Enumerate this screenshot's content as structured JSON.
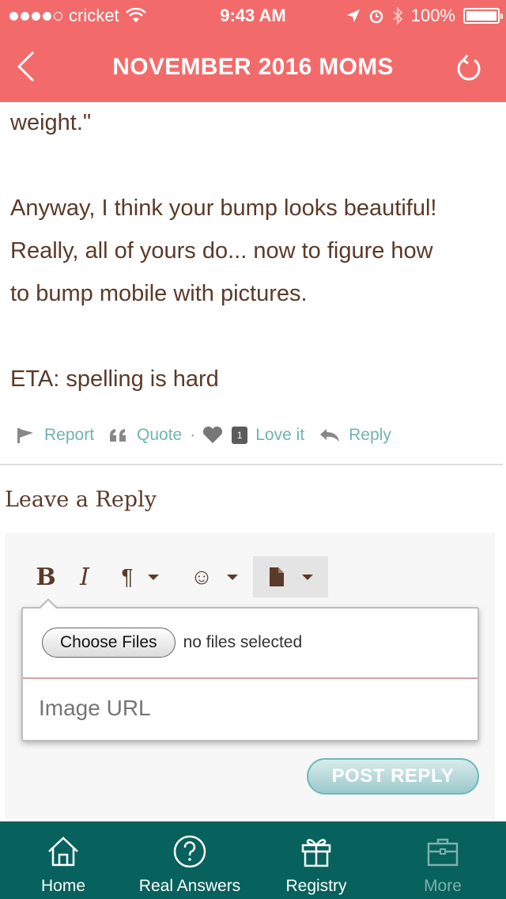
{
  "status_bar": {
    "carrier": "cricket",
    "time": "9:43 AM",
    "battery": "100%",
    "battery_fill": 1.0
  },
  "nav": {
    "title": "NOVEMBER 2016 MOMS"
  },
  "post": {
    "lines": [
      "weight.\"",
      "",
      "Anyway, I think your bump looks beautiful!",
      "Really, all of yours do... now to figure how",
      "to bump mobile with pictures.",
      "",
      "ETA: spelling is hard"
    ]
  },
  "actions": {
    "report": "Report",
    "quote": "Quote",
    "separator": "·",
    "love_count": "1",
    "love": "Love it",
    "reply": "Reply"
  },
  "reply_form": {
    "title": "Leave a Reply",
    "toolbar": {
      "bold": "B",
      "italic": "I",
      "paragraph": "¶",
      "emoji": "☺"
    },
    "file": {
      "choose_label": "Choose Files",
      "status": "no files selected"
    },
    "image_url": {
      "placeholder": "Image URL"
    },
    "submit_label": "POST REPLY"
  },
  "tabs": [
    {
      "label": "Home",
      "icon": "home-icon"
    },
    {
      "label": "Real Answers",
      "icon": "question-icon"
    },
    {
      "label": "Registry",
      "icon": "gift-icon"
    },
    {
      "label": "More",
      "icon": "briefcase-icon"
    }
  ],
  "colors": {
    "header": "#f26b6a",
    "tabbar": "#07615c",
    "text": "#5b3a29",
    "link": "#6fb3b3"
  }
}
